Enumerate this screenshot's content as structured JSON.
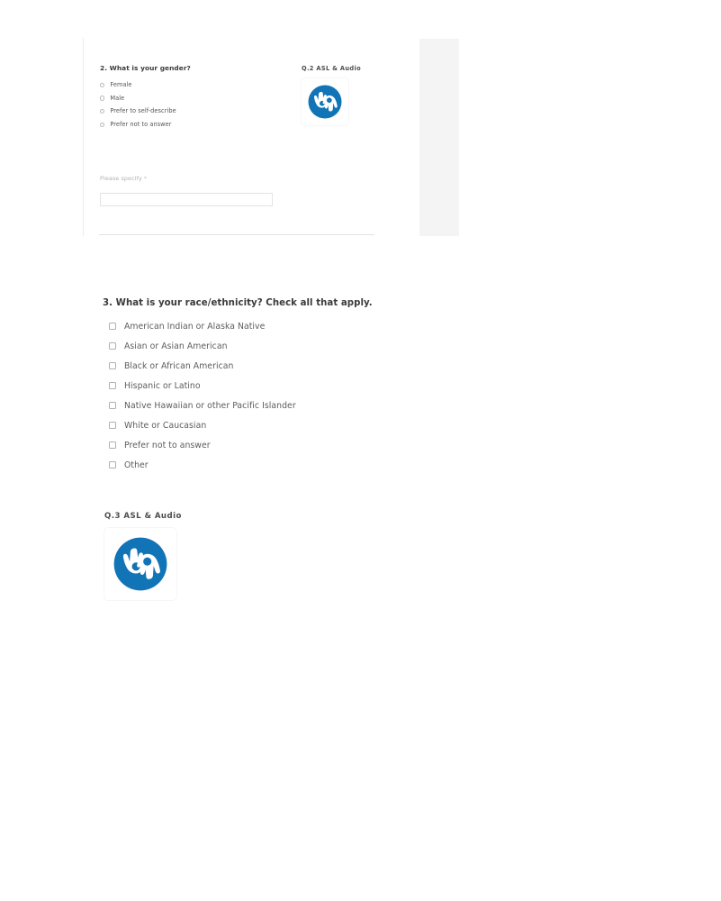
{
  "colors": {
    "asl_blue": "#1174b6",
    "asl_white": "#ffffff",
    "heading_text": "#3b3b3d",
    "body_text": "#5c5c60",
    "muted_text": "#b2b2b5",
    "divider": "#e2e2e3",
    "panel_grey": "#f4f4f5",
    "page_background": "#ffffff"
  },
  "question_2": {
    "heading": "2. What is your gender?",
    "options": [
      {
        "label": "Female",
        "selected": false
      },
      {
        "label": "Male",
        "selected": false
      },
      {
        "label": "Prefer to self-describe",
        "selected": false
      },
      {
        "label": "Prefer not to answer",
        "selected": false
      }
    ],
    "specify": {
      "label": "Please specify",
      "required_marker": "*",
      "value": "",
      "placeholder": ""
    },
    "media": {
      "title": "Q.2 ASL & Audio",
      "icon": "asl-interpreting-icon"
    }
  },
  "question_3": {
    "heading": "3. What is your race/ethnicity? Check all that apply.",
    "options": [
      {
        "label": "American Indian or Alaska Native",
        "checked": false
      },
      {
        "label": "Asian or Asian American",
        "checked": false
      },
      {
        "label": "Black or African American",
        "checked": false
      },
      {
        "label": "Hispanic or Latino",
        "checked": false
      },
      {
        "label": "Native Hawaiian or other Pacific Islander",
        "checked": false
      },
      {
        "label": "White or Caucasian",
        "checked": false
      },
      {
        "label": "Prefer not to answer",
        "checked": false
      },
      {
        "label": "Other",
        "checked": false
      }
    ],
    "media": {
      "title": "Q.3 ASL & Audio",
      "icon": "asl-interpreting-icon"
    }
  }
}
